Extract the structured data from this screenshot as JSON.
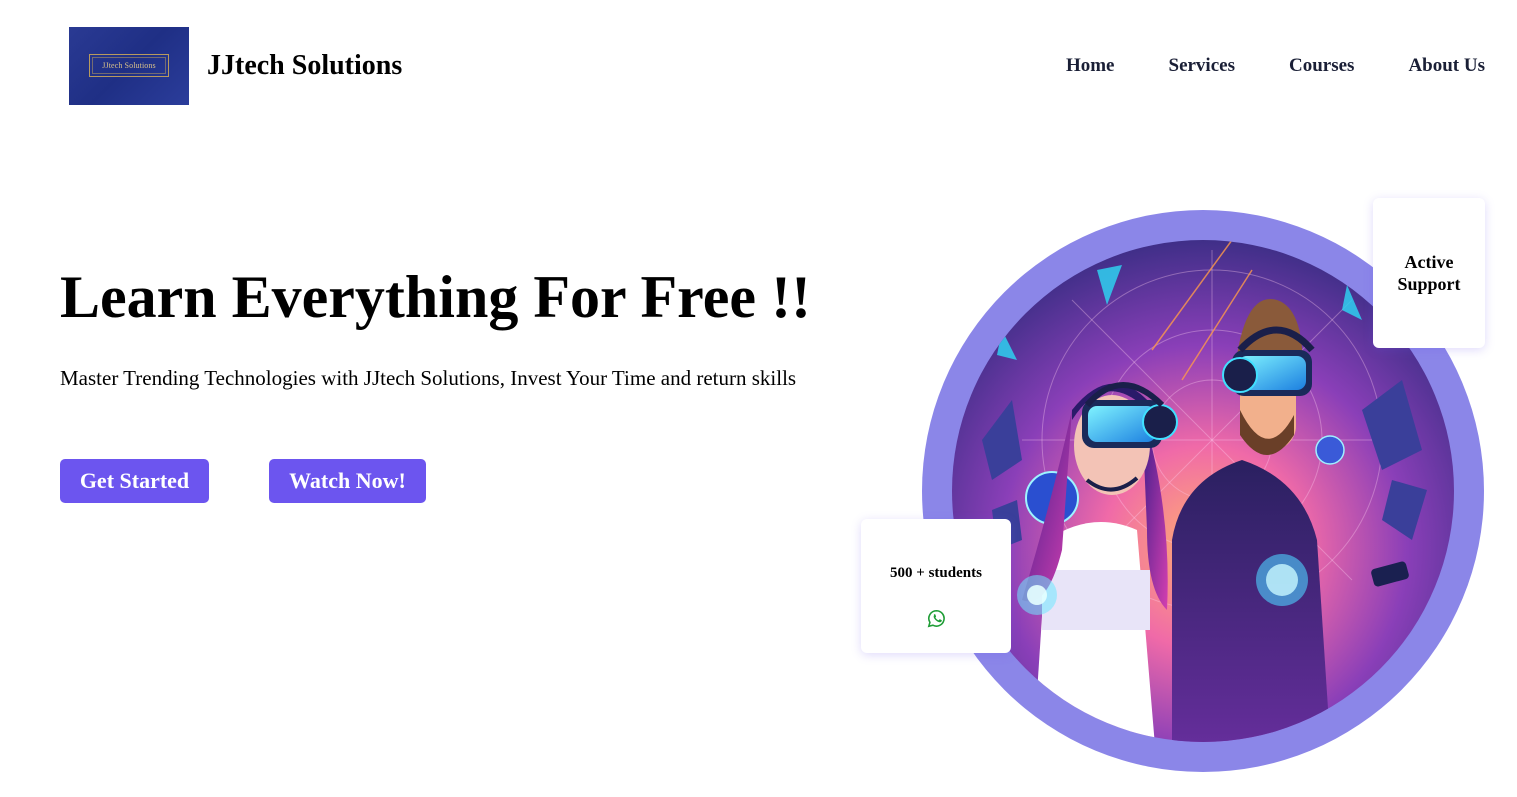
{
  "brand": {
    "logo_text": "JJtech Solutions",
    "name": "JJtech Solutions"
  },
  "nav": {
    "items": [
      {
        "label": "Home"
      },
      {
        "label": "Services"
      },
      {
        "label": "Courses"
      },
      {
        "label": "About Us"
      }
    ]
  },
  "hero": {
    "title": "Learn Everything For Free !!",
    "subtitle": "Master Trending Technologies with JJtech Solutions, Invest Your Time and return skills",
    "buttons": {
      "primary": "Get Started",
      "secondary": "Watch Now!"
    },
    "image_icon": "vr-users-illustration"
  },
  "cards": {
    "support": {
      "line1": "Active",
      "line2": "Support"
    },
    "students": {
      "label": "500 + students",
      "icon": "whatsapp-icon"
    }
  },
  "colors": {
    "accent": "#6c55ef",
    "ring": "#8b86e8",
    "logo_bg": "#24358f",
    "whatsapp": "#1f9d36"
  }
}
